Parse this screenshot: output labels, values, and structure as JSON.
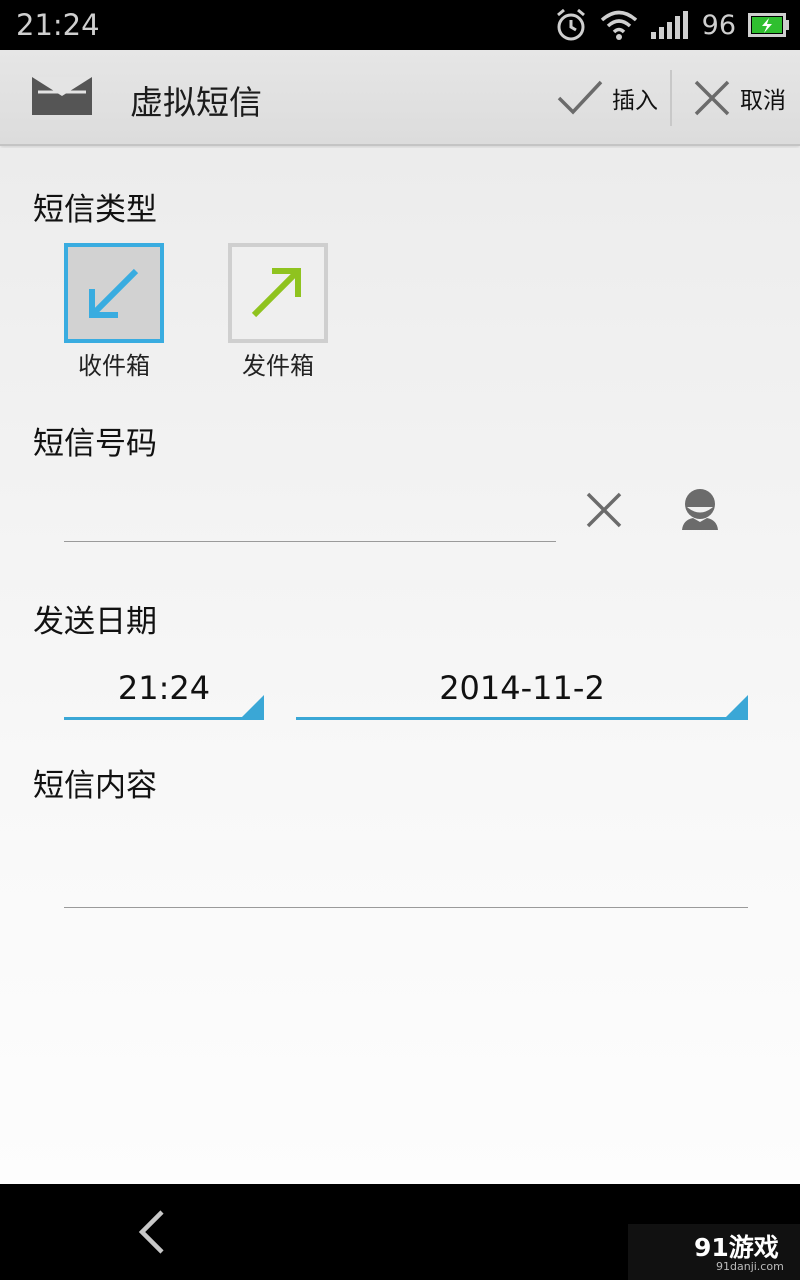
{
  "status_bar": {
    "time": "21:24",
    "battery_level": "96",
    "icons": [
      "alarm-icon",
      "wifi-icon",
      "signal-icon",
      "battery-charging-icon"
    ]
  },
  "action_bar": {
    "title": "虚拟短信",
    "insert_label": "插入",
    "cancel_label": "取消"
  },
  "sms_type": {
    "title": "短信类型",
    "inbox_label": "收件箱",
    "outbox_label": "发件箱",
    "selected": "inbox"
  },
  "sms_number": {
    "title": "短信号码",
    "value": ""
  },
  "send_date": {
    "title": "发送日期",
    "time": "21:24",
    "date": "2014-11-2"
  },
  "sms_content": {
    "title": "短信内容",
    "value": ""
  },
  "watermark": {
    "text": "91游戏",
    "sub": "91danji.com"
  },
  "colors": {
    "accent": "#3aa7d6",
    "inbox_arrow": "#39ace0",
    "outbox_arrow": "#8fc31f"
  }
}
